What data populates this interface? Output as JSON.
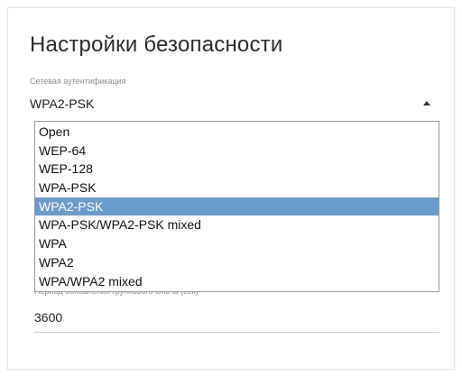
{
  "section_title": "Настройки безопасности",
  "auth_field": {
    "label": "Сетевая аутентификация",
    "value": "WPA2-PSK"
  },
  "dropdown": {
    "options": [
      "Open",
      "WEP-64",
      "WEP-128",
      "WPA-PSK",
      "WPA2-PSK",
      "WPA-PSK/WPA2-PSK mixed",
      "WPA",
      "WPA2",
      "WPA/WPA2 mixed"
    ],
    "selected": "WPA2-PSK"
  },
  "group_key_field": {
    "label": "Период обновления группового ключа (сек)*",
    "value": "3600"
  },
  "colors": {
    "selected_option_bg": "#6b9bc9",
    "text": "#1e1e1e",
    "label": "#8c8c8c"
  }
}
